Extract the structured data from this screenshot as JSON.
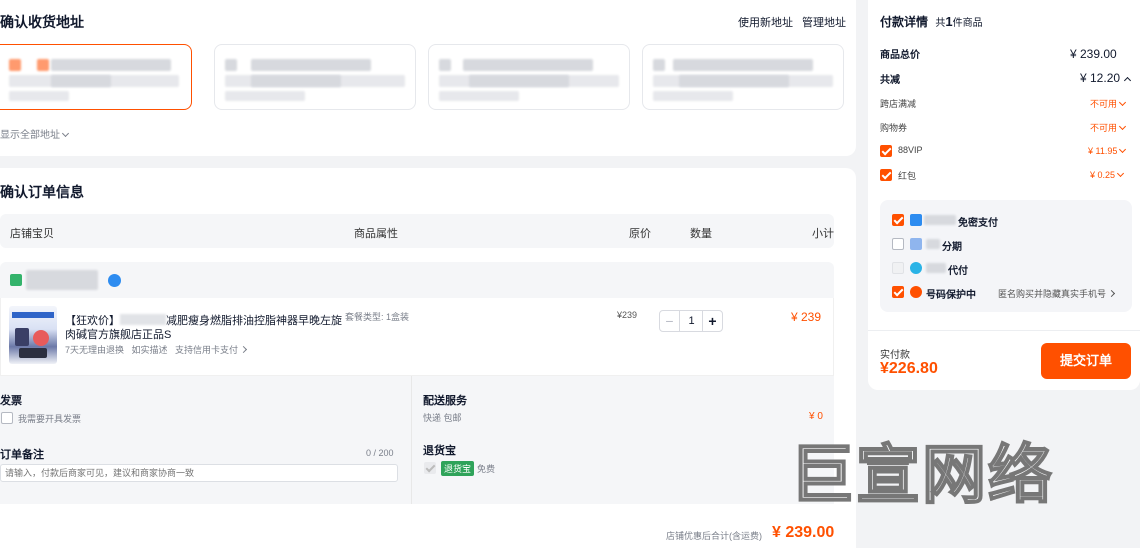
{
  "address": {
    "title": "确认收货地址",
    "use_new": "使用新地址",
    "manage": "管理地址",
    "show_all": "显示全部地址"
  },
  "order": {
    "title": "确认订单信息",
    "headers": {
      "store_item": "店铺宝贝",
      "attrs": "商品属性",
      "price": "原价",
      "qty": "数量",
      "subtotal": "小计"
    },
    "item": {
      "name_prefix": "【狂欢价】",
      "name_rest": "减肥瘦身燃脂排油控脂神器早晚左旋",
      "name_line2": "肉碱官方旗舰店正品S",
      "tags": "7天无理由退换   如实描述   支持信用卡支付",
      "attr": "套餐类型: 1盒装",
      "price": "¥239",
      "quantity": "1",
      "subtotal": "¥ 239"
    },
    "invoice": {
      "title": "发票",
      "label": "我需要开具发票"
    },
    "note": {
      "title": "订单备注",
      "count": "0 / 200",
      "placeholder": "请输入，付款后商家可见，建议和商家协商一致"
    },
    "shipping": {
      "title": "配送服务",
      "method": "快递 包邮",
      "fee": "¥ 0"
    },
    "return_insurance": {
      "title": "退货宝",
      "badge": "退货宝",
      "free": "免费"
    },
    "store_total_label": "店铺优惠后合计(含运费)",
    "store_total": "¥ 239.00"
  },
  "payment": {
    "title": "付款详情",
    "count_prefix": "共",
    "count": "1",
    "count_suffix": "件商品",
    "goods_total_label": "商品总价",
    "goods_total": "¥ 239.00",
    "discount_label": "共减",
    "discount": "¥ 12.20",
    "cross_store_label": "跨店满减",
    "cross_store_value": "不可用",
    "coupon_label": "购物券",
    "coupon_value": "不可用",
    "vip_label": "88VIP",
    "vip_value": "¥ 11.95",
    "redpack_label": "红包",
    "redpack_value": "¥ 0.25",
    "options": [
      {
        "label": "免密支付"
      },
      {
        "label": "分期"
      },
      {
        "label": "代付"
      },
      {
        "label": "号码保护中",
        "desc": "匿名购买并隐藏真实手机号"
      }
    ],
    "actual_label": "实付款",
    "actual": "¥226.80",
    "submit": "提交订单"
  },
  "watermark": "巨宣网络",
  "colors": {
    "accent": "#ff5000",
    "text": "#11192d",
    "muted": "#7a7f8a"
  }
}
